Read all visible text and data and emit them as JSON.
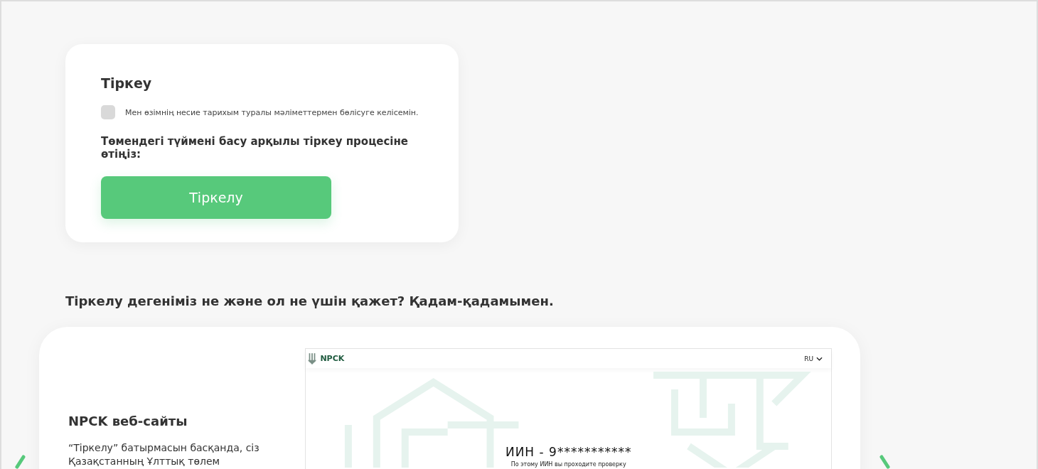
{
  "registration_card": {
    "title": "Тіркеу",
    "consent": {
      "label": "Мен өзімнің несие тарихым туралы мәліметтермен бөлісуге келісемін.",
      "checked": false
    },
    "instruction": "Төмендегі түймені басу арқылы тіркеу процесіне өтіңіз:",
    "button": "Тіркелу"
  },
  "section_title": "Тіркелу дегеніміз не және ол не үшін қажет? Қадам-қадамымен.",
  "carousel": {
    "slide": {
      "title": "NPCK веб-сайты",
      "text": "“Тіркелу” батырмасын басқанда, сіз Қазақстанның Ұлттық төлем",
      "screenshot": {
        "brand": "NPCK",
        "language": "RU",
        "iin": "ИИН - 9***********",
        "note": "По этому ИИН вы проходите проверку"
      }
    }
  }
}
